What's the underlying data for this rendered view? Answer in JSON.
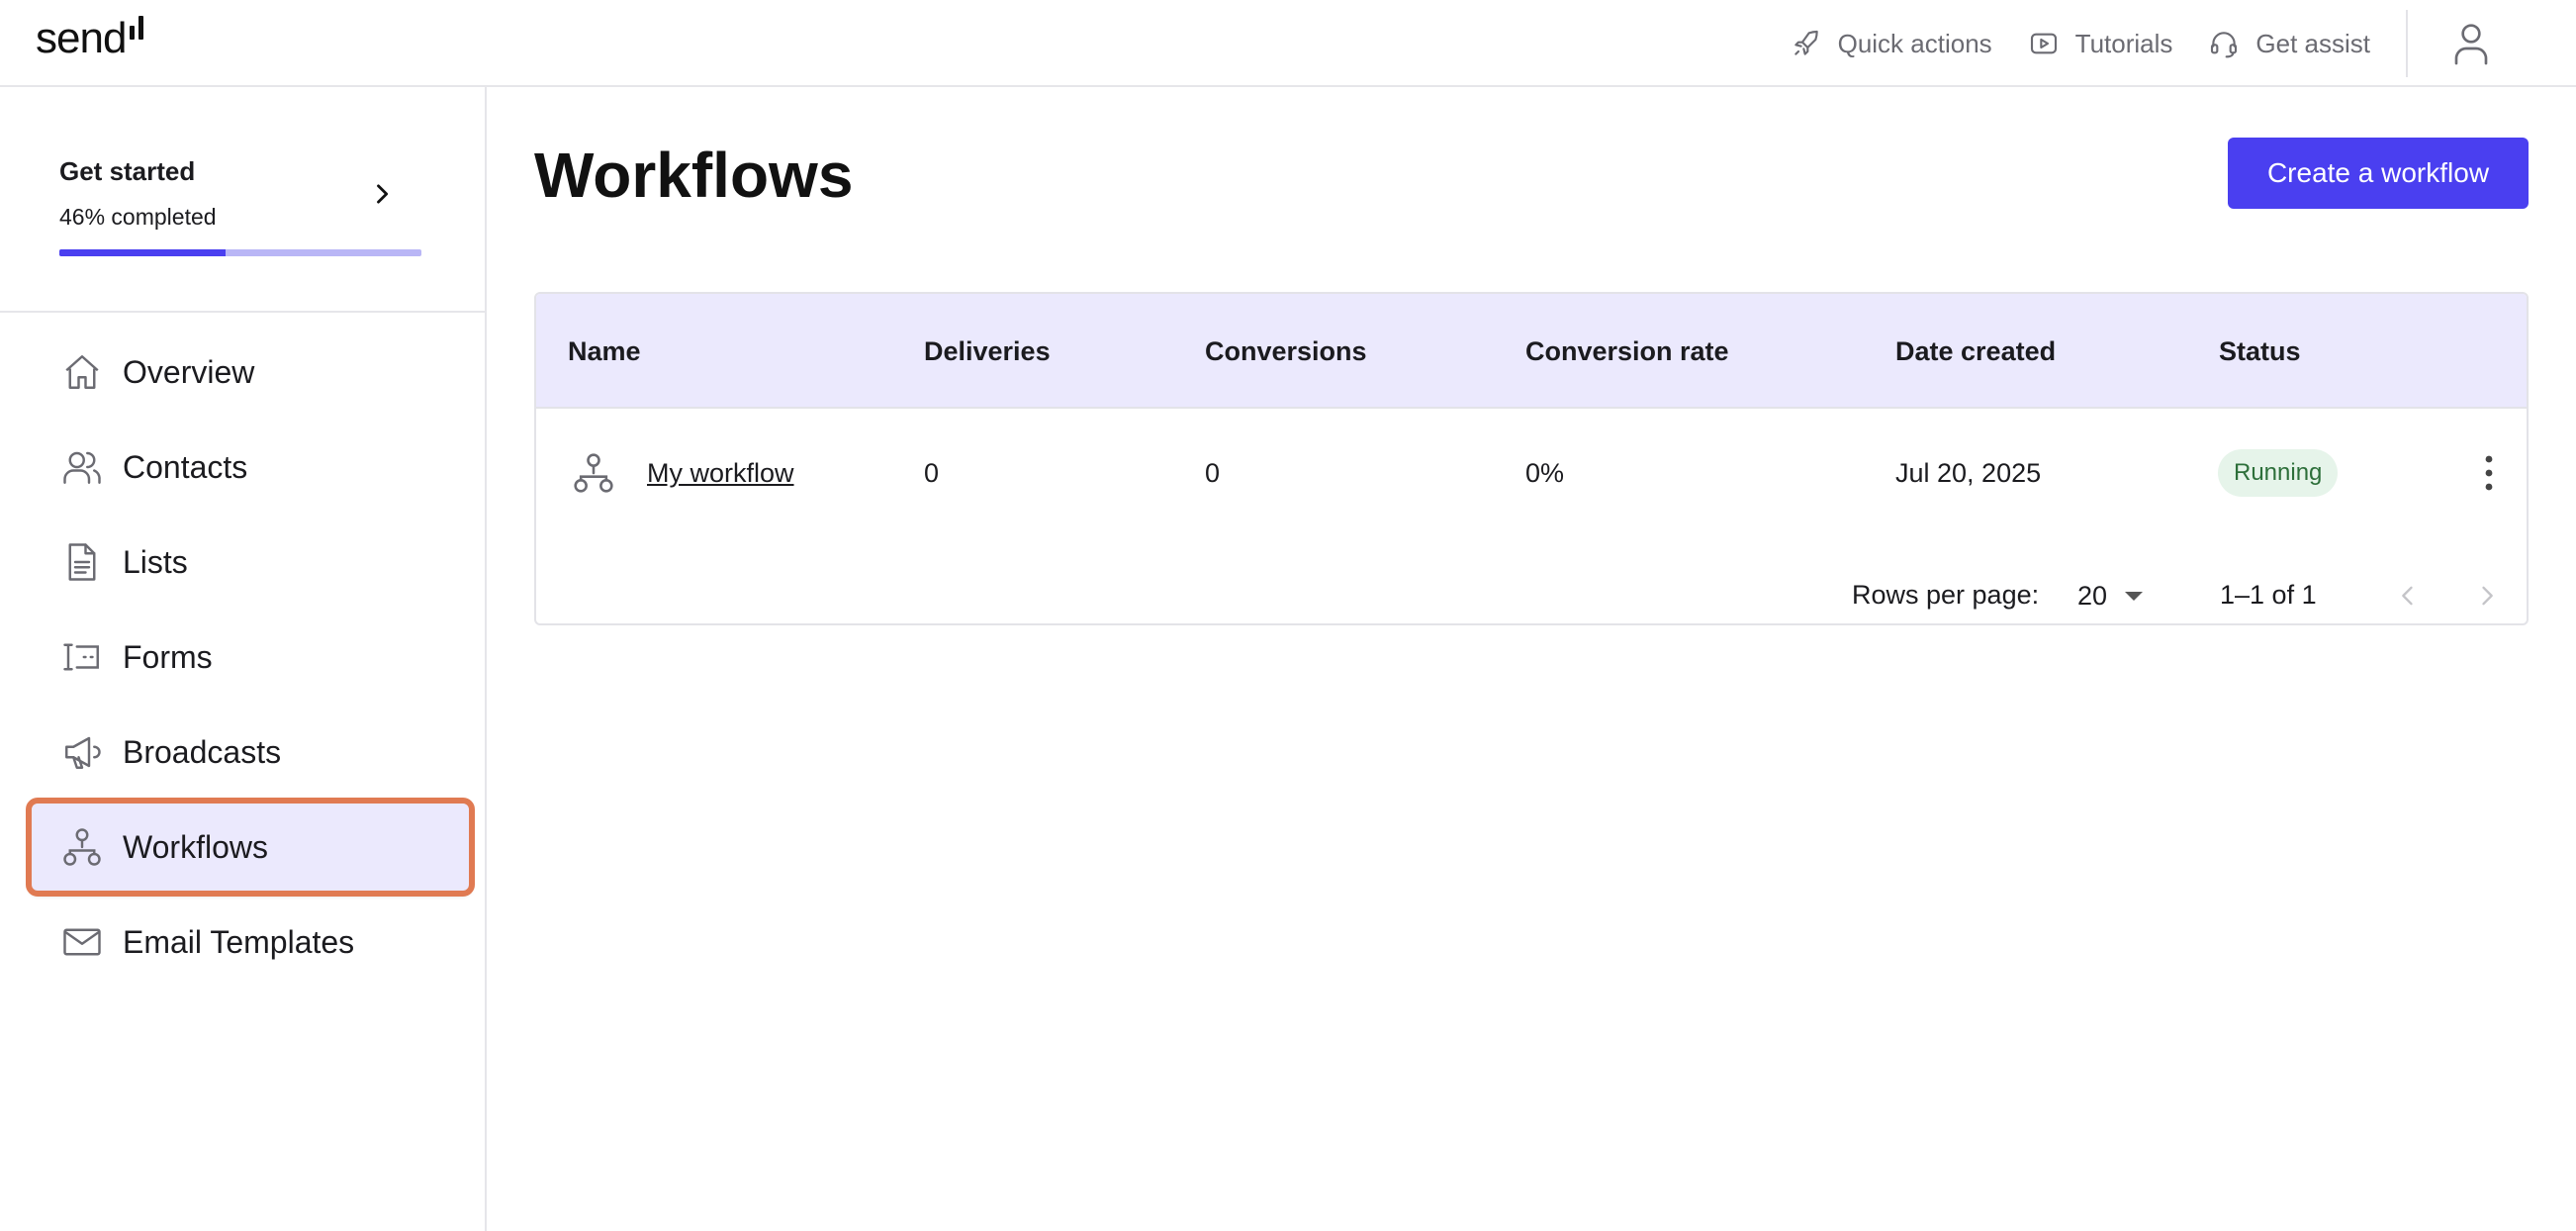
{
  "app": {
    "logo_text": "send"
  },
  "topbar": {
    "actions": [
      {
        "label": "Quick actions",
        "icon": "rocket-icon"
      },
      {
        "label": "Tutorials",
        "icon": "play-icon"
      },
      {
        "label": "Get assist",
        "icon": "headset-icon"
      }
    ],
    "profile_icon": "user-icon"
  },
  "sidebar": {
    "get_started": {
      "title": "Get started",
      "subtitle": "46% completed",
      "progress": 0.46
    },
    "items": [
      {
        "label": "Overview",
        "icon": "home-icon"
      },
      {
        "label": "Contacts",
        "icon": "contacts-icon"
      },
      {
        "label": "Lists",
        "icon": "list-document-icon"
      },
      {
        "label": "Forms",
        "icon": "form-icon"
      },
      {
        "label": "Broadcasts",
        "icon": "megaphone-icon"
      },
      {
        "label": "Workflows",
        "icon": "workflow-icon",
        "active": true
      },
      {
        "label": "Email Templates",
        "icon": "envelope-icon"
      }
    ]
  },
  "main": {
    "title": "Workflows",
    "create_button": "Create a workflow",
    "table": {
      "columns": [
        "Name",
        "Deliveries",
        "Conversions",
        "Conversion rate",
        "Date created",
        "Status"
      ],
      "rows": [
        {
          "name": "My workflow",
          "deliveries": "0",
          "conversions": "0",
          "conversion_rate": "0%",
          "date_created": "Jul 20, 2025",
          "status": "Running"
        }
      ]
    },
    "pagination": {
      "rows_per_page_label": "Rows per page:",
      "rows_per_page": "20",
      "range": "1–1 of 1"
    }
  },
  "colors": {
    "accent": "#4a3ff0",
    "header_bg": "#ebe9fd",
    "status_bg": "#e6f4ea",
    "status_text": "#2d6f3a",
    "highlight": "#e07a52"
  }
}
